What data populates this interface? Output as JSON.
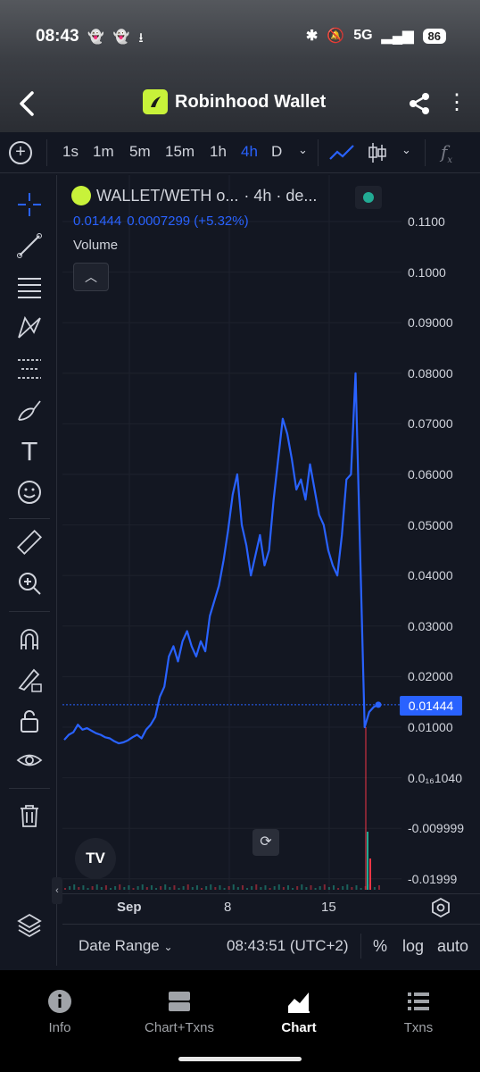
{
  "status": {
    "time": "08:43",
    "network": "5G",
    "battery": "86"
  },
  "header": {
    "title": "Robinhood Wallet"
  },
  "toolbar": {
    "timeframes": [
      "1s",
      "1m",
      "5m",
      "15m",
      "1h",
      "4h",
      "D"
    ],
    "active_timeframe": "4h"
  },
  "legend": {
    "symbol": "WALLET/WETH o...",
    "interval": "· 4h · de...",
    "price": "0.01444",
    "change": "0.0007299 (+5.32%)",
    "volume_label": "Volume"
  },
  "price_axis": {
    "labels": [
      "0.1100",
      "0.1000",
      "0.09000",
      "0.08000",
      "0.07000",
      "0.06000",
      "0.05000",
      "0.04000",
      "0.03000",
      "0.02000",
      "0.01000",
      "0.0₁₆1040",
      "-0.009999",
      "-0.01999"
    ],
    "current_price_tag": "0.01444"
  },
  "time_axis": {
    "labels": [
      "Sep",
      "8",
      "15"
    ]
  },
  "bottom_bar": {
    "date_range": "Date Range",
    "clock": "08:43:51 (UTC+2)",
    "percent": "%",
    "log": "log",
    "auto": "auto"
  },
  "nav": {
    "tabs": [
      "Info",
      "Chart+Txns",
      "Chart",
      "Txns"
    ],
    "active": "Chart"
  },
  "colors": {
    "line": "#2962ff",
    "accent_logo": "#c8f23a",
    "status_dot": "#22ab94"
  },
  "chart_data": {
    "type": "line",
    "series": [
      {
        "values": [
          0.0075,
          0.0085,
          0.009,
          0.0105,
          0.0095,
          0.0098,
          0.0093,
          0.0088,
          0.0085,
          0.008,
          0.0078,
          0.0072,
          0.0068,
          0.007,
          0.0074,
          0.008,
          0.0085,
          0.0078,
          0.0095,
          0.0105,
          0.012,
          0.016,
          0.018,
          0.024,
          0.026,
          0.023,
          0.027,
          0.029,
          0.026,
          0.024,
          0.027,
          0.025,
          0.032,
          0.035,
          0.038,
          0.043,
          0.049,
          0.056,
          0.06,
          0.05,
          0.046,
          0.04,
          0.044,
          0.048,
          0.042,
          0.045,
          0.055,
          0.063,
          0.071,
          0.068,
          0.063,
          0.057,
          0.059,
          0.055,
          0.062,
          0.057,
          0.052,
          0.05,
          0.045,
          0.042,
          0.04,
          0.048,
          0.059,
          0.06,
          0.08,
          0.045,
          0.01,
          0.013,
          0.014,
          0.01444
        ]
      }
    ],
    "x_labels": [
      "Sep",
      "8",
      "15"
    ],
    "ylim": [
      -0.02,
      0.11
    ]
  }
}
